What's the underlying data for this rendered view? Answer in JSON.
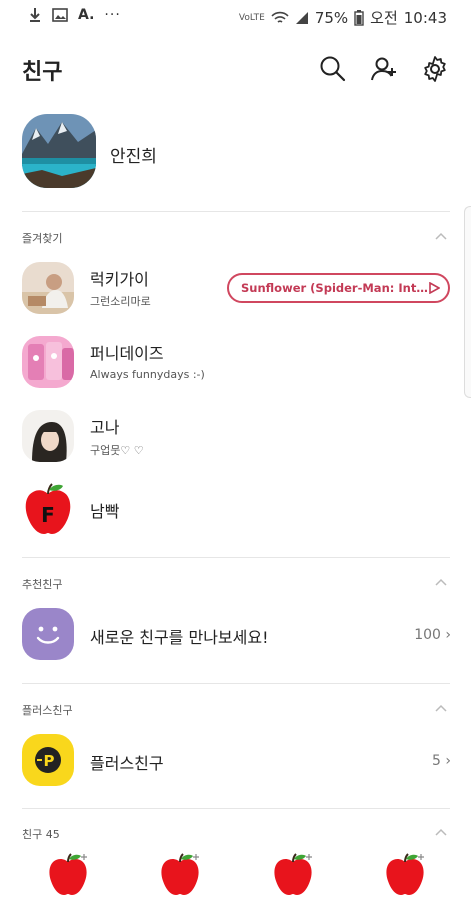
{
  "status_bar": {
    "battery": "75%",
    "time_prefix": "오전",
    "time": "10:43",
    "volte": "VoLTE"
  },
  "header": {
    "title": "친구"
  },
  "my_profile": {
    "name": "안진희"
  },
  "favorites": {
    "label": "즐겨찾기",
    "items": [
      {
        "name": "럭키가이",
        "status": "그런소리마로",
        "music": "Sunflower (Spider-Man: Into..."
      },
      {
        "name": "퍼니데이즈",
        "status": "Always funnydays :-)"
      },
      {
        "name": "고나",
        "status": "구업뭇♡ ♡"
      },
      {
        "name": "남빡",
        "status": ""
      }
    ]
  },
  "recommended": {
    "label": "추천친구",
    "item_name": "새로운 친구를 만나보세요!",
    "count": "100"
  },
  "plus_friends": {
    "label": "플러스친구",
    "item_name": "플러스친구",
    "count": "5"
  },
  "friends": {
    "label": "친구 45"
  },
  "colors": {
    "accent_pink": "#d0475f",
    "apple_red": "#e8141c",
    "plus_yellow": "#f9d71c",
    "purple": "#9a86c9"
  }
}
